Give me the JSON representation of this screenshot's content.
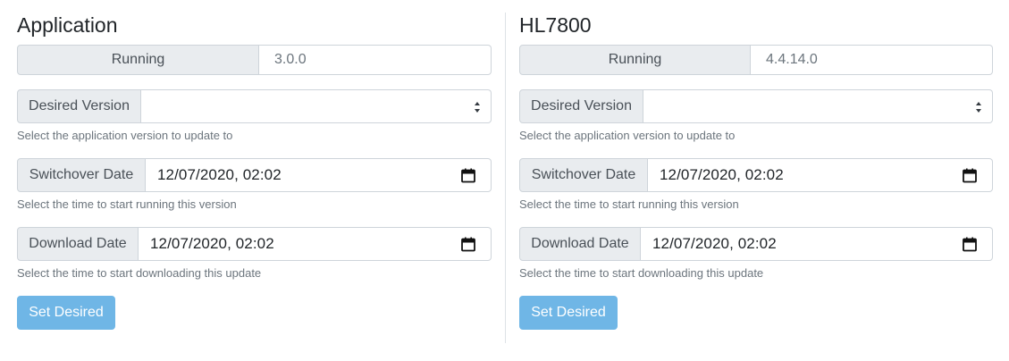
{
  "application": {
    "title": "Application",
    "running_label": "Running",
    "running_value": "3.0.0",
    "desired_label": "Desired Version",
    "desired_value": "",
    "desired_help": "Select the application version to update to",
    "switchover_label": "Switchover Date",
    "switchover_value": "12/07/2020, 02:02",
    "switchover_help": "Select the time to start running this version",
    "download_label": "Download Date",
    "download_value": "12/07/2020, 02:02",
    "download_help": "Select the time to start downloading this update",
    "button_label": "Set Desired"
  },
  "hl7800": {
    "title": "HL7800",
    "running_label": "Running",
    "running_value": "4.4.14.0",
    "desired_label": "Desired Version",
    "desired_value": "",
    "desired_help": "Select the application version to update to",
    "switchover_label": "Switchover Date",
    "switchover_value": "12/07/2020, 02:02",
    "switchover_help": "Select the time to start running this version",
    "download_label": "Download Date",
    "download_value": "12/07/2020, 02:02",
    "download_help": "Select the time to start downloading this update",
    "button_label": "Set Desired"
  },
  "colors": {
    "addon_bg": "#e9ecef",
    "border": "#ced4da",
    "button_bg": "#6fb6e6",
    "help_text": "#6c757d"
  }
}
